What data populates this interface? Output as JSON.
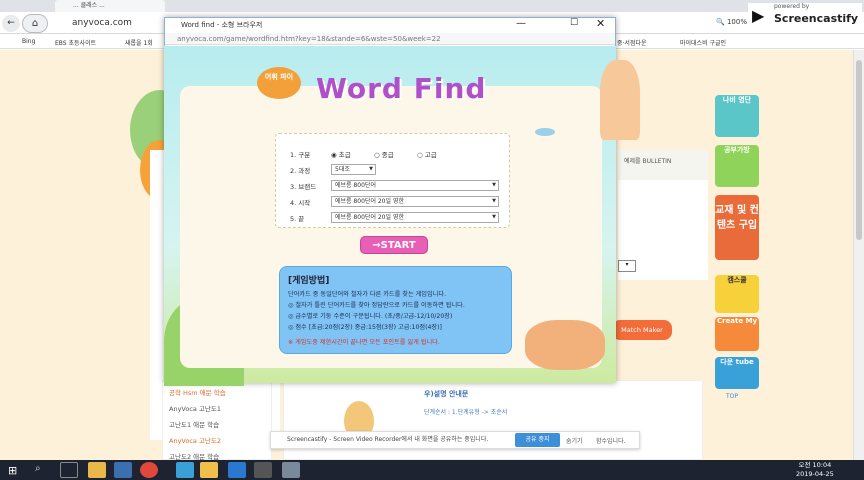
{
  "browser": {
    "tab_title": "... 클래스 ...",
    "url": "anyvoca.com",
    "zoom": "100%",
    "bookmarks": [
      "Bing",
      "EBS 초등사이트",
      "새롭을 1회",
      "중·서점다운",
      "마이대스비 구글인"
    ]
  },
  "castify": {
    "powered": "powered by",
    "brand": "Screencastify"
  },
  "popup": {
    "window_title": "Word find - 소형 브라우저",
    "url": "anyvoca.com/game/wordfind.htm?key=18&stande=6&wste=50&week=22",
    "game": {
      "badge": "어휘 파이",
      "title": "Word Find",
      "form": {
        "row1_label": "1. 구분",
        "options": [
          "초급",
          "중급",
          "고급"
        ],
        "row2_label": "2. 과정",
        "course_value": "5대조",
        "row3_label": "3. 브랜드",
        "brand_value": "에브릉 800단어",
        "row4_label": "4. 시작",
        "start_value": "에브릉 800단어 20일 영한",
        "row5_label": "5. 끝",
        "end_value": "에브릉 800단어 20일 영한"
      },
      "start_button": "→START",
      "howto": {
        "title": "[게임방법]",
        "lines": [
          "단어카드 중 동일단어와 철자가 다른 카드를 찾는 게임입니다.",
          "◎ 철자가 틀린 단어카드를 찾아 정답란으로 카드를 이동하면 됩니다.",
          "◎ 급수별로 기둥 수준이 구분됩니다. (초/중/고급-12/10/20장)",
          "◎ 점수 [초급:20점(2장) 중급:15점(3장) 고급:10점(4장)]"
        ],
        "warning": "※ 게임도중 제한시간이 끝나면 모든 포인트를 잃게 됩니다."
      }
    }
  },
  "background": {
    "left_menu": [
      "공학 Hsm 애문 학습",
      "AnyVoca 고난도1",
      "고난도1 애문 학습",
      "AnyVoca 고난도2",
      "고난도2 애문 학습"
    ],
    "lower_title": "우)설명 안내문",
    "lower_sub": "단계순서 : 1.단계유형 -> 초순서",
    "right_buttons": [
      "나비 영단",
      "공부가방",
      "교재 및 컨텐츠 구입",
      "캠스쿨",
      "Create My",
      "다운 tube"
    ],
    "top_label": "TOP",
    "match_maker": "Match Maker",
    "breadcrumb": "예제를 BULLETIN"
  },
  "notice": {
    "text": "Screencastify - Screen Video Recorder에서 내 화면을 공유하는 중입니다.",
    "stop": "공유 중지",
    "hide": "숨기기",
    "tail": "함수입니다."
  },
  "taskbar": {
    "time": "오전 10:04",
    "date": "2019-04-25"
  }
}
